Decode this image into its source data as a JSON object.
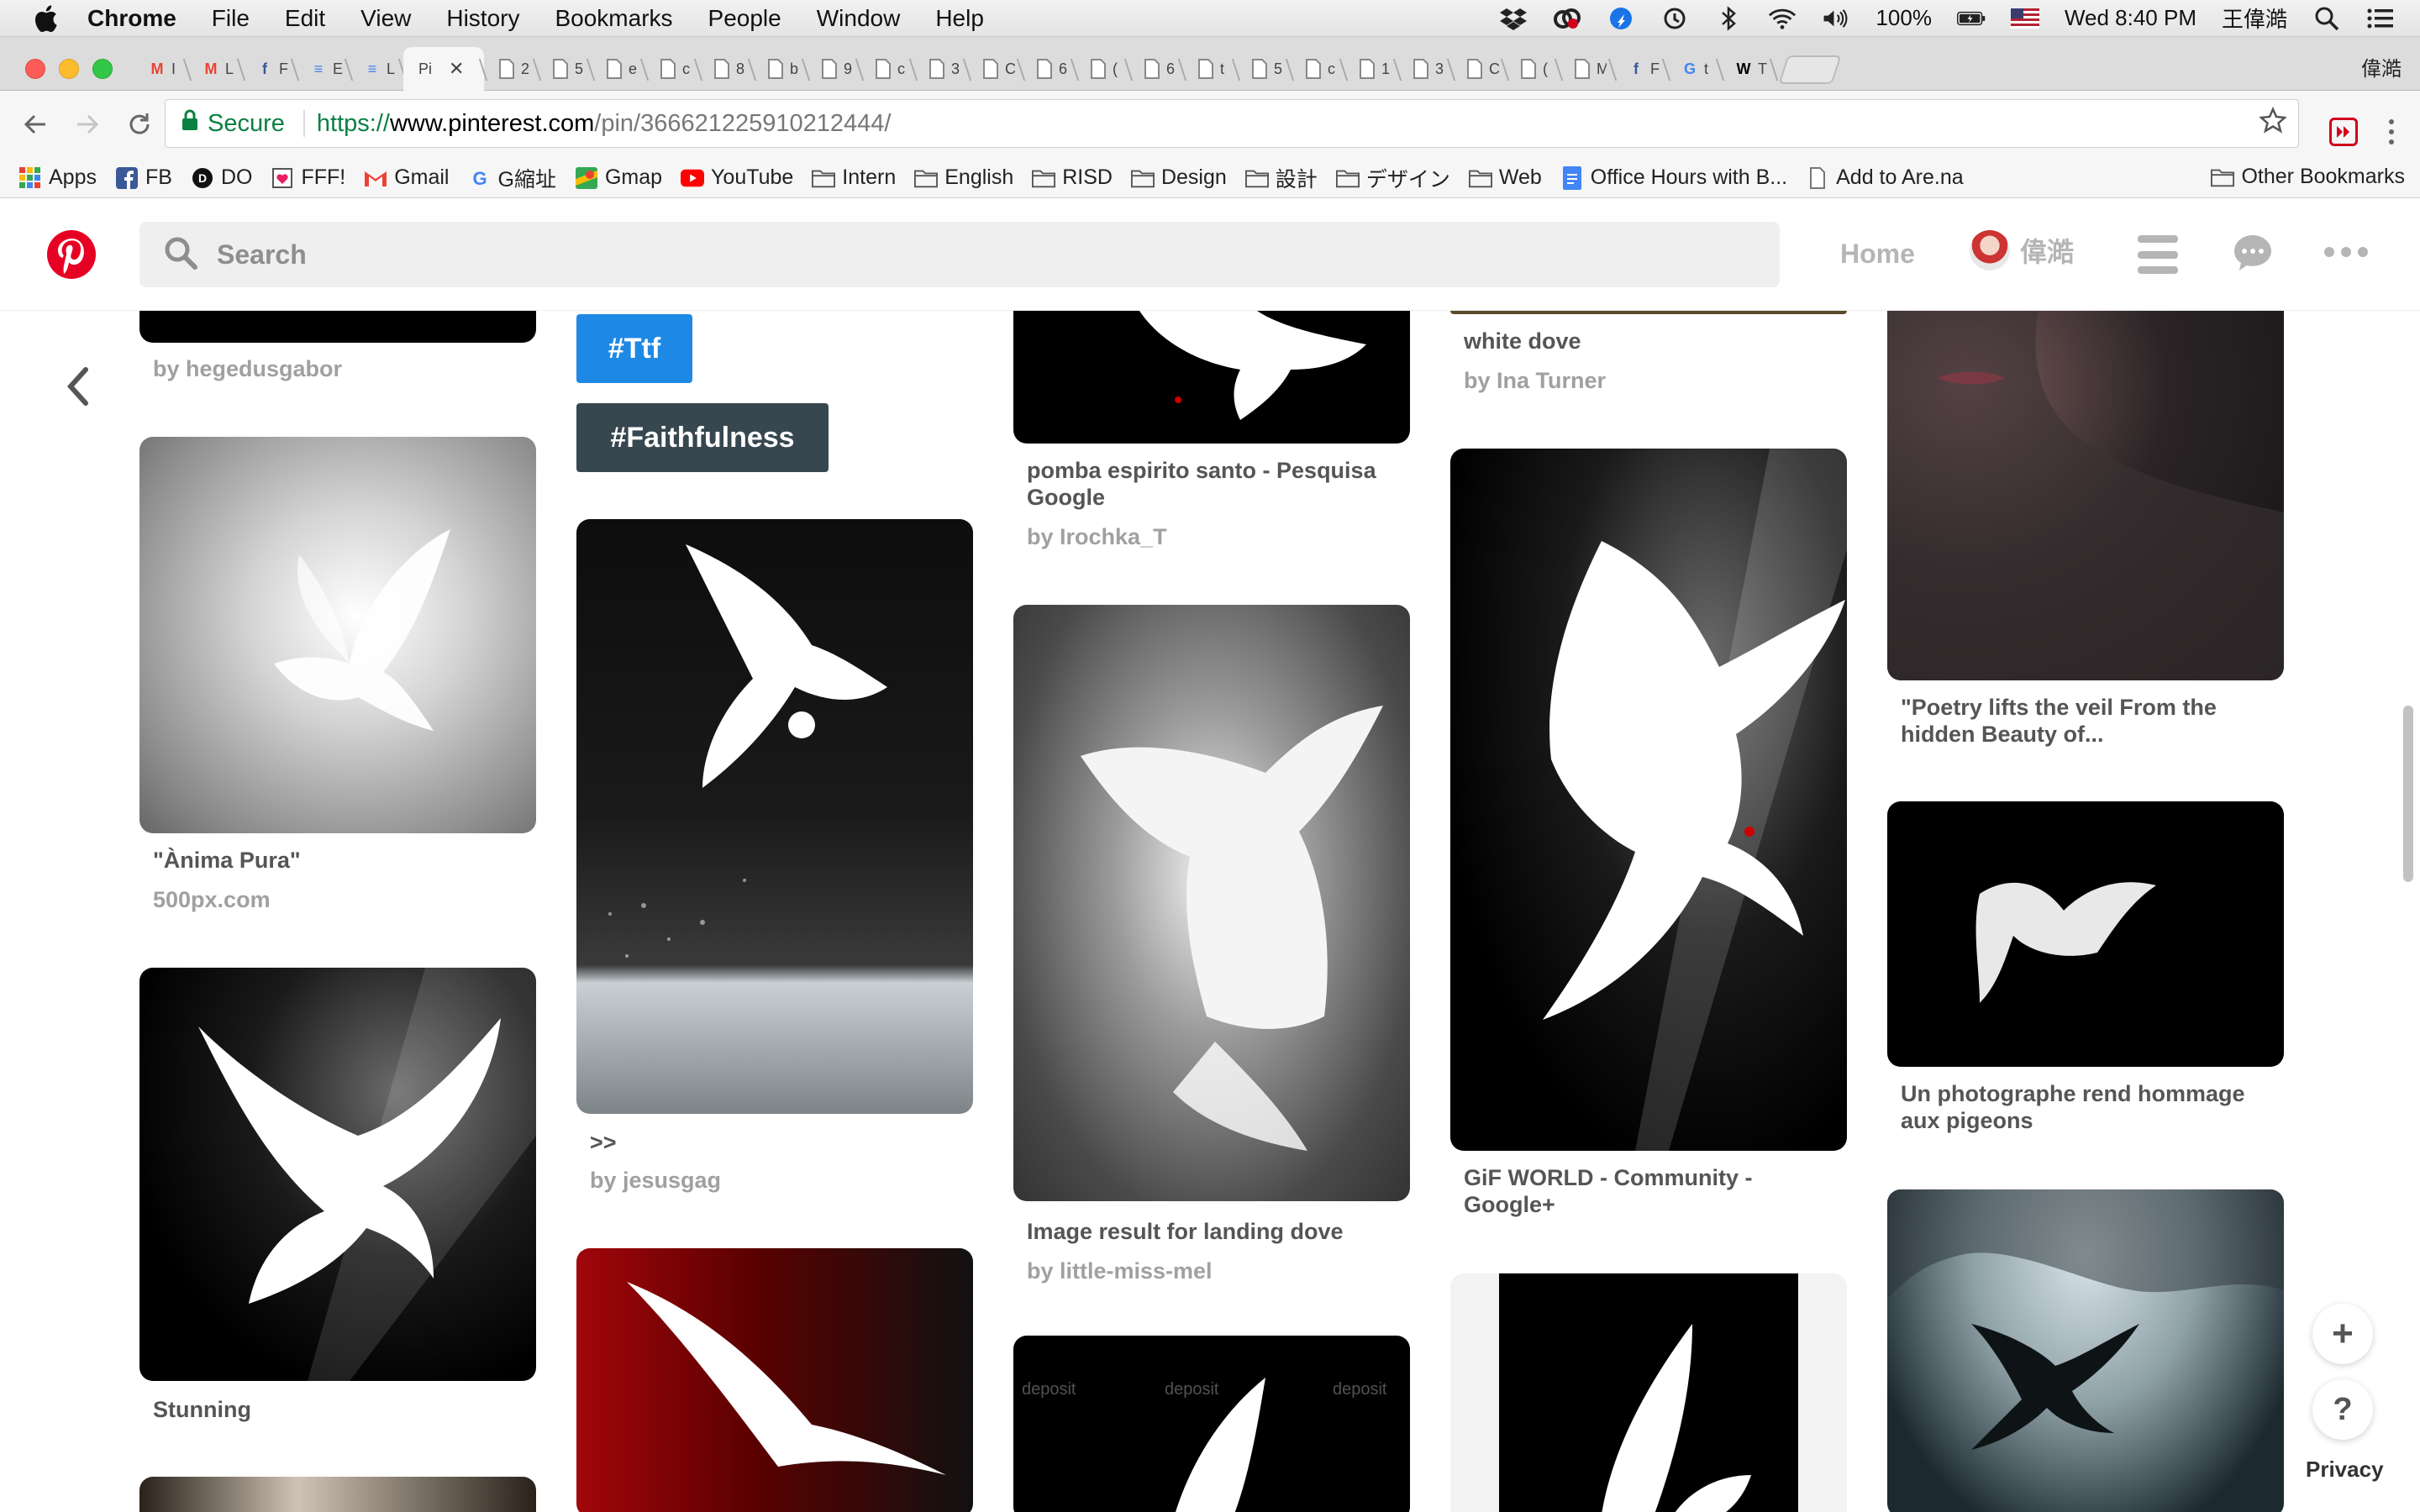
{
  "menubar": {
    "app": "Chrome",
    "items": [
      "File",
      "Edit",
      "View",
      "History",
      "Bookmarks",
      "People",
      "Window",
      "Help"
    ],
    "battery": "100%",
    "datetime": "Wed 8:40 PM",
    "user": "王偉澔",
    "icons": [
      "dropbox-icon",
      "creative-cloud-icon",
      "app-icon",
      "time-machine-icon",
      "bluetooth-icon",
      "wifi-icon",
      "volume-icon",
      "battery-icon",
      "us-flag-icon",
      "spotlight-icon",
      "notification-center-icon"
    ]
  },
  "tabstrip": {
    "profile_name": "偉澔",
    "active_tab_title": "Pi",
    "tabs": [
      {
        "fav": "M",
        "color": "#ea4335",
        "label": "I"
      },
      {
        "fav": "M",
        "color": "#ea4335",
        "label": "L"
      },
      {
        "fav": "f",
        "color": "#3b5998",
        "label": "F"
      },
      {
        "fav": "≡",
        "color": "#4285f4",
        "label": "E"
      },
      {
        "fav": "≡",
        "color": "#4285f4",
        "label": "L"
      },
      {
        "fav": "",
        "color": "#999999",
        "label": "2"
      },
      {
        "fav": "",
        "color": "#999999",
        "label": "5"
      },
      {
        "fav": "",
        "color": "#999999",
        "label": "e"
      },
      {
        "fav": "",
        "color": "#999999",
        "label": "c"
      },
      {
        "fav": "",
        "color": "#999999",
        "label": "8"
      },
      {
        "fav": "",
        "color": "#999999",
        "label": "b"
      },
      {
        "fav": "",
        "color": "#999999",
        "label": "9"
      },
      {
        "fav": "",
        "color": "#999999",
        "label": "c"
      },
      {
        "fav": "",
        "color": "#999999",
        "label": "3"
      },
      {
        "fav": "",
        "color": "#999999",
        "label": "C"
      },
      {
        "fav": "",
        "color": "#999999",
        "label": "6"
      },
      {
        "fav": "",
        "color": "#999999",
        "label": "("
      },
      {
        "fav": "",
        "color": "#999999",
        "label": "6"
      },
      {
        "fav": "",
        "color": "#999999",
        "label": "t"
      },
      {
        "fav": "",
        "color": "#999999",
        "label": "5"
      },
      {
        "fav": "",
        "color": "#999999",
        "label": "c"
      },
      {
        "fav": "",
        "color": "#999999",
        "label": "1"
      },
      {
        "fav": "",
        "color": "#999999",
        "label": "3"
      },
      {
        "fav": "",
        "color": "#999999",
        "label": "C"
      },
      {
        "fav": "",
        "color": "#999999",
        "label": "("
      },
      {
        "fav": "",
        "color": "#999999",
        "label": "M"
      },
      {
        "fav": "f",
        "color": "#3b5998",
        "label": "F"
      },
      {
        "fav": "G",
        "color": "#4285f4",
        "label": "t"
      },
      {
        "fav": "W",
        "color": "#000000",
        "label": "T"
      }
    ]
  },
  "toolbar": {
    "secure_label": "Secure",
    "url_scheme": "https://",
    "url_host": "www.pinterest.com",
    "url_path": "/pin/366621225910212444/"
  },
  "bookmarks": {
    "items": [
      {
        "label": "Apps",
        "icon": "apps-grid-icon"
      },
      {
        "label": "FB",
        "icon": "facebook-icon"
      },
      {
        "label": "DO",
        "icon": "do-icon"
      },
      {
        "label": "FFF!",
        "icon": "fff-icon"
      },
      {
        "label": "Gmail",
        "icon": "gmail-icon"
      },
      {
        "label": "G縮址",
        "icon": "google-icon"
      },
      {
        "label": "Gmap",
        "icon": "maps-icon"
      },
      {
        "label": "YouTube",
        "icon": "youtube-icon"
      },
      {
        "label": "Intern",
        "icon": "folder-icon"
      },
      {
        "label": "English",
        "icon": "folder-icon"
      },
      {
        "label": "RISD",
        "icon": "folder-icon"
      },
      {
        "label": "Design",
        "icon": "folder-icon"
      },
      {
        "label": "設計",
        "icon": "folder-icon"
      },
      {
        "label": "デザイン",
        "icon": "folder-icon"
      },
      {
        "label": "Web",
        "icon": "folder-icon"
      },
      {
        "label": "Office Hours with B...",
        "icon": "doc-icon"
      },
      {
        "label": "Add to Are.na",
        "icon": "page-icon"
      }
    ],
    "other": "Other Bookmarks"
  },
  "header": {
    "search_placeholder": "Search",
    "home": "Home",
    "user": "偉澔"
  },
  "pins": {
    "col1_top_sub": "by hegedusgabor",
    "anima_title": "\"Ànima Pura\"",
    "anima_sub": "500px.com",
    "stunning_title": "Stunning",
    "tag_ttf": "#Ttf",
    "tag_faith": "#Faithfulness",
    "jesus_title": ">>",
    "jesus_sub": "by jesusgag",
    "pomba_title": "pomba espirito santo - Pesquisa Google",
    "pomba_sub": "by Irochka_T",
    "landing_title": "Image result for landing dove",
    "landing_sub": "by little-miss-mel",
    "whitedove_title": "white dove",
    "whitedove_sub": "by Ina Turner",
    "gif_title": "GiF WORLD - Community - Google+",
    "poetry_title": "\"Poetry lifts the veil From the hidden Beauty of...",
    "photographe_title": "Un photographe rend hommage aux pigeons"
  },
  "footer": {
    "add": "+",
    "help": "?",
    "privacy": "Privacy"
  }
}
